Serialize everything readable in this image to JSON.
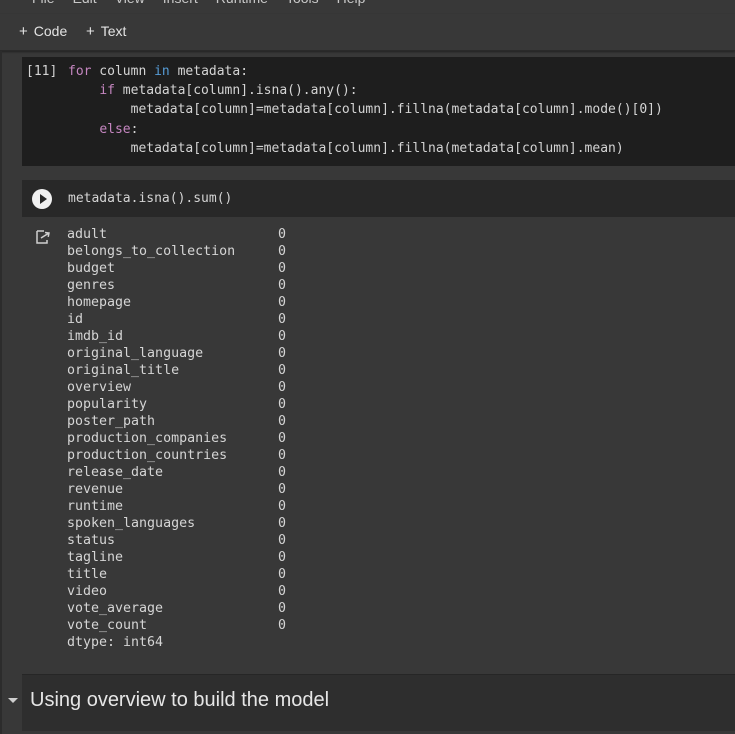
{
  "menu": [
    "File",
    "Edit",
    "View",
    "Insert",
    "Runtime",
    "Tools",
    "Help"
  ],
  "toolbar": {
    "code_label": "Code",
    "text_label": "Text",
    "plus": "+"
  },
  "cell_prev": {
    "prompt": "[11]",
    "lines": [
      [
        {
          "t": "for",
          "c": "kw"
        },
        {
          "t": " column ",
          "c": ""
        },
        {
          "t": "in",
          "c": "kw2"
        },
        {
          "t": " metadata:",
          "c": ""
        }
      ],
      [
        {
          "t": "    ",
          "c": ""
        },
        {
          "t": "if",
          "c": "kw"
        },
        {
          "t": " metadata[column].isna().any():",
          "c": ""
        }
      ],
      [
        {
          "t": "        metadata[column]=metadata[column].fillna(metadata[column].mode()[0])",
          "c": ""
        }
      ],
      [
        {
          "t": "    ",
          "c": ""
        },
        {
          "t": "else",
          "c": "kw"
        },
        {
          "t": ":",
          "c": ""
        }
      ],
      [
        {
          "t": "        metadata[column]=metadata[column].fillna(metadata[column].mean)",
          "c": ""
        }
      ]
    ]
  },
  "cell_active": {
    "code": "metadata.isna().sum()"
  },
  "output": {
    "rows": [
      {
        "name": "adult",
        "value": "0"
      },
      {
        "name": "belongs_to_collection",
        "value": "0"
      },
      {
        "name": "budget",
        "value": "0"
      },
      {
        "name": "genres",
        "value": "0"
      },
      {
        "name": "homepage",
        "value": "0"
      },
      {
        "name": "id",
        "value": "0"
      },
      {
        "name": "imdb_id",
        "value": "0"
      },
      {
        "name": "original_language",
        "value": "0"
      },
      {
        "name": "original_title",
        "value": "0"
      },
      {
        "name": "overview",
        "value": "0"
      },
      {
        "name": "popularity",
        "value": "0"
      },
      {
        "name": "poster_path",
        "value": "0"
      },
      {
        "name": "production_companies",
        "value": "0"
      },
      {
        "name": "production_countries",
        "value": "0"
      },
      {
        "name": "release_date",
        "value": "0"
      },
      {
        "name": "revenue",
        "value": "0"
      },
      {
        "name": "runtime",
        "value": "0"
      },
      {
        "name": "spoken_languages",
        "value": "0"
      },
      {
        "name": "status",
        "value": "0"
      },
      {
        "name": "tagline",
        "value": "0"
      },
      {
        "name": "title",
        "value": "0"
      },
      {
        "name": "video",
        "value": "0"
      },
      {
        "name": "vote_average",
        "value": "0"
      },
      {
        "name": "vote_count",
        "value": "0"
      }
    ],
    "dtype": "dtype: int64"
  },
  "section": {
    "title": "Using overview to build the model"
  }
}
